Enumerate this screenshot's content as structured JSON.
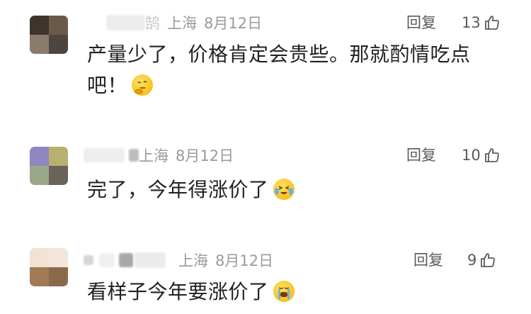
{
  "comments": [
    {
      "name_fragment": "鹄",
      "location": "上海",
      "date": "8月12日",
      "reply": "回复",
      "likes": "13",
      "text_line1": "产量少了，价格肯定会贵些。那就酌情吃点",
      "text_line2": "吧！",
      "emoji": "thinking-face-emoji"
    },
    {
      "name_fragment": "",
      "location": "上海",
      "date": "8月12日",
      "reply": "回复",
      "likes": "10",
      "text_line1": "完了，今年得涨价了",
      "emoji": "crying-laughing-face-emoji"
    },
    {
      "name_fragment": "",
      "location": "上海",
      "date": "8月12日",
      "reply": "回复",
      "likes": "9",
      "text_line1": "看样子今年要涨价了",
      "emoji": "crying-face-emoji"
    }
  ],
  "colors": {
    "meta": "#9a9a9a",
    "text": "#222222",
    "action": "#5a5a5a"
  }
}
